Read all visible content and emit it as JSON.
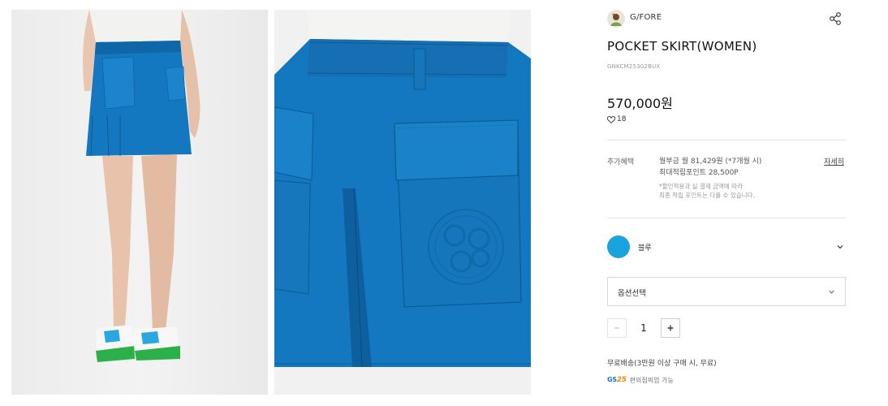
{
  "brand": {
    "name": "G/FORE"
  },
  "product": {
    "title": "POCKET SKIRT(WOMEN)",
    "code": "GNKCM25302BUX",
    "price": "570,000원",
    "likes": "18"
  },
  "benefits": {
    "label": "추가혜택",
    "installment": "월부금 월 81,429원 (*7개월 시)",
    "points": "최대적립포인트 28,500P",
    "note_1": "*할인적용과 실 결제 금액에 따라",
    "note_2": "최종 적립 포인트는 다를 수 있습니다.",
    "detail_link": "자세히"
  },
  "color": {
    "name": "블루",
    "swatch": "#1aa3dd"
  },
  "option": {
    "placeholder": "옵션선택"
  },
  "quantity": {
    "value": "1",
    "minus": "−",
    "plus": "+"
  },
  "shipping": {
    "text": "무료배송(3만원 이상 구매 시, 무료)",
    "gs_logo_text": "GS",
    "gs_logo_num": "25",
    "pickup_text": "편의점픽업 가능"
  },
  "colors": {
    "skirt": "#1478c0",
    "skirt_dark": "#0e5f9e",
    "accent": "#1aa3dd"
  }
}
